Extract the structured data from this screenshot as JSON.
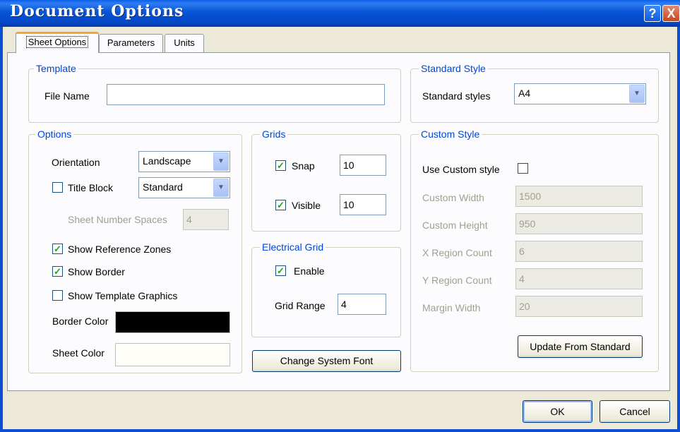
{
  "window": {
    "title": "Document Options",
    "help_glyph": "?",
    "close_glyph": "X"
  },
  "tabs": [
    "Sheet Options",
    "Parameters",
    "Units"
  ],
  "template": {
    "title": "Template",
    "file_name_label": "File Name",
    "file_name_value": ""
  },
  "standard_style": {
    "title": "Standard Style",
    "label": "Standard styles",
    "value": "A4"
  },
  "options": {
    "title": "Options",
    "orientation_label": "Orientation",
    "orientation_value": "Landscape",
    "title_block_label": "Title Block",
    "title_block_checked": false,
    "title_block_value": "Standard",
    "sheet_number_spaces_label": "Sheet Number Spaces",
    "sheet_number_spaces_value": "4",
    "show_reference_zones_label": "Show Reference Zones",
    "show_reference_zones_checked": true,
    "show_border_label": "Show Border",
    "show_border_checked": true,
    "show_template_graphics_label": "Show Template Graphics",
    "show_template_graphics_checked": false,
    "border_color_label": "Border Color",
    "border_color": "#000000",
    "sheet_color_label": "Sheet Color",
    "sheet_color": "#fffff7"
  },
  "grids": {
    "title": "Grids",
    "snap_label": "Snap",
    "snap_checked": true,
    "snap_value": "10",
    "visible_label": "Visible",
    "visible_checked": true,
    "visible_value": "10"
  },
  "electrical_grid": {
    "title": "Electrical Grid",
    "enable_label": "Enable",
    "enable_checked": true,
    "grid_range_label": "Grid Range",
    "grid_range_value": "4"
  },
  "change_font_button": "Change System Font",
  "custom_style": {
    "title": "Custom Style",
    "use_custom_label": "Use Custom style",
    "use_custom_checked": false,
    "width_label": "Custom Width",
    "width_value": "1500",
    "height_label": "Custom Height",
    "height_value": "950",
    "x_region_label": "X Region Count",
    "x_region_value": "6",
    "y_region_label": "Y Region Count",
    "y_region_value": "4",
    "margin_label": "Margin Width",
    "margin_value": "20",
    "update_button": "Update From Standard"
  },
  "footer": {
    "ok": "OK",
    "cancel": "Cancel"
  },
  "icons": {
    "checkbox_checked": "checkmark-icon",
    "dropdown": "chevron-down-icon"
  }
}
